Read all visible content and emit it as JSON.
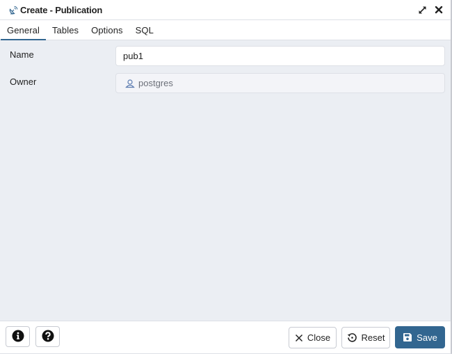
{
  "dialog": {
    "title": "Create - Publication",
    "icons": {
      "title": "publication-satellite-icon",
      "maximize": "expand-arrows-icon",
      "close": "close-x-icon"
    }
  },
  "tabs": [
    {
      "label": "General",
      "active": true
    },
    {
      "label": "Tables",
      "active": false
    },
    {
      "label": "Options",
      "active": false
    },
    {
      "label": "SQL",
      "active": false
    }
  ],
  "form": {
    "name": {
      "label": "Name",
      "value": "pub1"
    },
    "owner": {
      "label": "Owner",
      "value": "postgres",
      "icon": "user-icon",
      "disabled": true
    }
  },
  "footer": {
    "info_icon": "info-circle-icon",
    "help_icon": "question-circle-icon",
    "close_label": "Close",
    "reset_label": "Reset",
    "save_label": "Save"
  },
  "colors": {
    "accent": "#326690",
    "content_bg": "#ebeef3",
    "border": "#dde0e6"
  }
}
